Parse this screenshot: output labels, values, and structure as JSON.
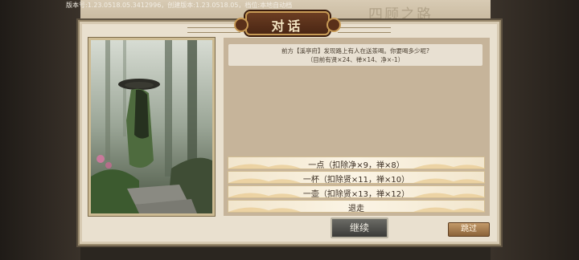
{
  "version_text": "版本号:1.23.0518.05.3412996，创建版本:1.23.0518.05，档位:本地自动档",
  "background_title": "四顾之路",
  "dialog": {
    "title": "对话",
    "question_line1": "前方【溪亭府】发现路上有人在送茶喝。你要喝多少呢?",
    "question_line2": "（目前有贤×24、禅×14、净×-1）"
  },
  "choices": [
    {
      "label": "一点（扣除净×9，禅×8）"
    },
    {
      "label": "一杯（扣除贤×11，禅×10）"
    },
    {
      "label": "一壶（扣除贤×13，禅×12）"
    },
    {
      "label": "退走"
    }
  ],
  "buttons": {
    "continue": "继续",
    "skip": "跳过"
  },
  "colors": {
    "panel_bg": "#e9e0cf",
    "dialog_bg": "#c6b49a",
    "title_plaque": "#5a3019",
    "choice_bg": "#fbf4e5"
  }
}
